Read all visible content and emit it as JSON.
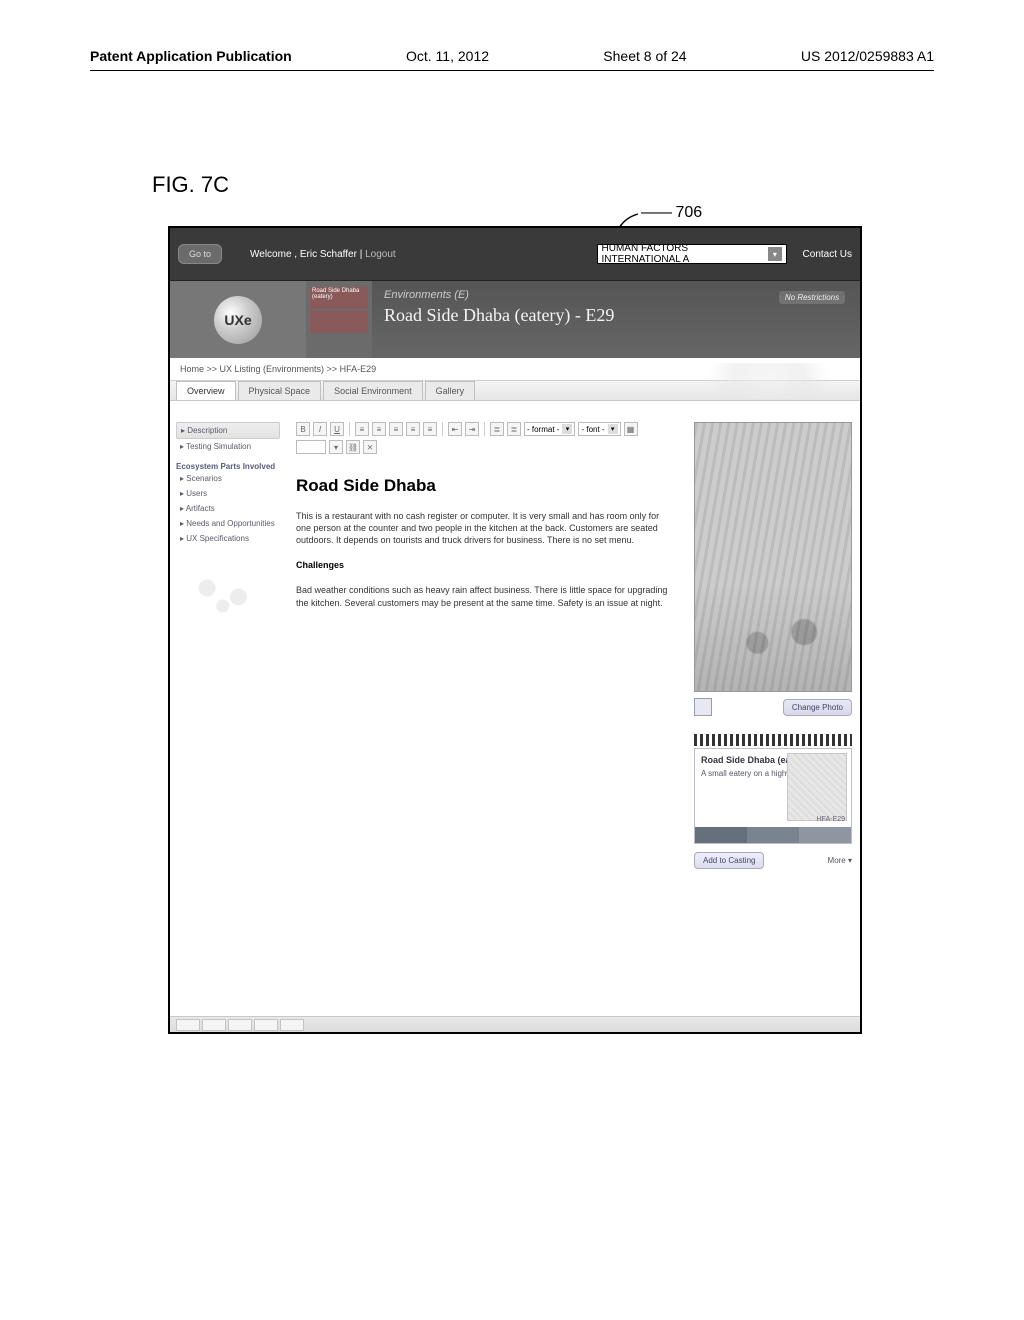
{
  "page_header": {
    "publication": "Patent Application Publication",
    "date": "Oct. 11, 2012",
    "sheet": "Sheet 8 of 24",
    "code": "US 2012/0259883 A1"
  },
  "figure_label": "FIG. 7C",
  "reference_number": "706",
  "topbar": {
    "goto": "Go to",
    "welcome_prefix": "Welcome ,",
    "user": "Eric Schaffer",
    "logout": "Logout",
    "org_selected": "HUMAN FACTORS INTERNATIONAL A",
    "contact": "Contact Us"
  },
  "banner": {
    "logo_text": "UXe",
    "thumb1": "Road Side Dhaba (eatery)",
    "thumb2": "",
    "category": "Environments (E)",
    "title": "Road Side Dhaba (eatery) - E29",
    "badge": "No Restrictions"
  },
  "breadcrumb": "Home >> UX Listing (Environments) >> HFA-E29",
  "tabs": [
    "Overview",
    "Physical Space",
    "Social Environment",
    "Gallery"
  ],
  "sidebar": {
    "items_top": [
      "Description",
      "Testing Simulation"
    ],
    "section_head": "Ecosystem Parts Involved",
    "items_eco": [
      "Scenarios",
      "Users",
      "Artifacts",
      "Needs and Opportunities",
      "UX Specifications"
    ]
  },
  "rte": {
    "format_label": "- format -",
    "font_label": "- font -"
  },
  "document": {
    "title": "Road Side Dhaba",
    "p1": "This is a restaurant with no cash register or computer. It is very small and has room only for one person at the counter and two people in the kitchen at the back. Customers are seated outdoors. It depends on tourists and truck drivers for business. There is no set menu.",
    "h2": "Challenges",
    "p2": "Bad weather conditions such as heavy rain affect business. There is little space for upgrading the kitchen. Several customers may be present at the same time. Safety is an issue at night."
  },
  "rail": {
    "change_photo": "Change Photo",
    "card": {
      "title": "Road Side Dhaba (eatery)",
      "desc": "A small eatery on a highway",
      "id": "HFA-E29",
      "footer": [
        "",
        "",
        ""
      ]
    },
    "add_to_casting": "Add to Casting",
    "more": "More ▾"
  }
}
